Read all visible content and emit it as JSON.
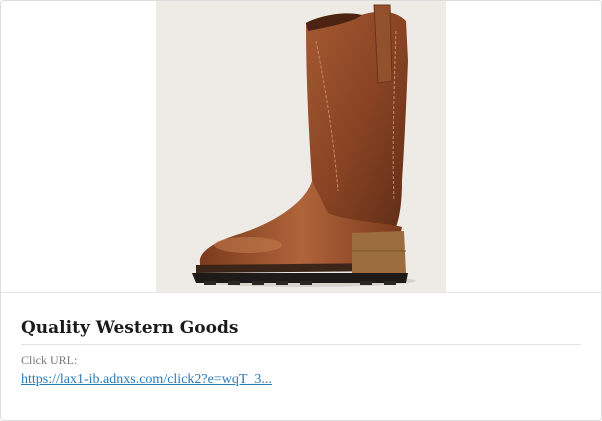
{
  "ad": {
    "image_alt": "Brown leather western boot",
    "title": "Quality Western Goods",
    "click_url_label": "Click URL:",
    "click_url": "https://lax1-ib.adnxs.com/click2?e=wqT_3..."
  },
  "colors": {
    "image_background": "#eeebe7",
    "boot_leather": "#8a4424",
    "link": "#2a7ab8"
  }
}
